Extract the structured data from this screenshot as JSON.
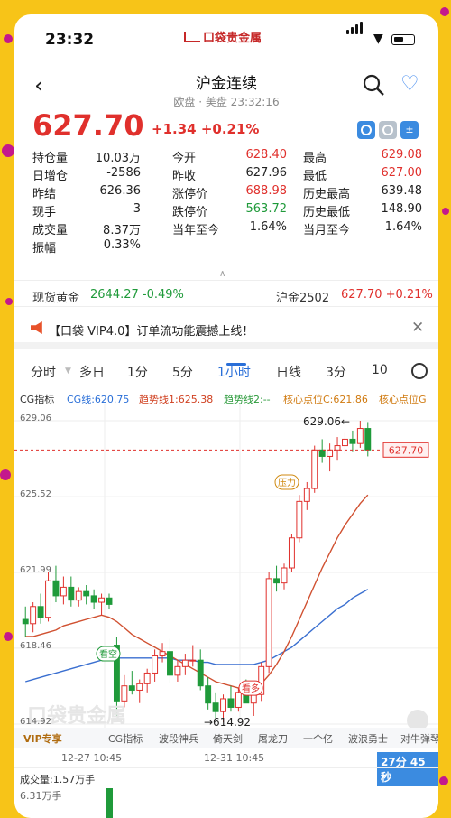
{
  "status_bar": {
    "time": "23:32",
    "brand": "口袋贵金属"
  },
  "header": {
    "title": "沪金连续",
    "subtitle": "欧盘 · 美盘 23:32:16"
  },
  "quote": {
    "price": "627.70",
    "change": "+1.34",
    "change_pct": "+0.21%"
  },
  "stats": [
    [
      {
        "k": "持仓量",
        "v": "10.03万",
        "c": ""
      },
      {
        "k": "今开",
        "v": "628.40",
        "c": "red"
      },
      {
        "k": "最高",
        "v": "629.08",
        "c": "red"
      }
    ],
    [
      {
        "k": "日增仓",
        "v": "-2586",
        "c": ""
      },
      {
        "k": "昨收",
        "v": "627.96",
        "c": ""
      },
      {
        "k": "最低",
        "v": "627.00",
        "c": "red"
      }
    ],
    [
      {
        "k": "昨结",
        "v": "626.36",
        "c": ""
      },
      {
        "k": "涨停价",
        "v": "688.98",
        "c": "red"
      },
      {
        "k": "历史最高",
        "v": "639.48",
        "c": ""
      }
    ],
    [
      {
        "k": "现手",
        "v": "3",
        "c": ""
      },
      {
        "k": "跌停价",
        "v": "563.72",
        "c": "green"
      },
      {
        "k": "历史最低",
        "v": "148.90",
        "c": ""
      }
    ],
    [
      {
        "k": "成交量",
        "v": "8.37万",
        "c": ""
      },
      {
        "k": "当年至今",
        "v": "1.64%",
        "c": ""
      },
      {
        "k": "当月至今",
        "v": "1.64%",
        "c": ""
      }
    ],
    [
      {
        "k": "振幅",
        "v": "0.33%",
        "c": ""
      }
    ]
  ],
  "spot": {
    "left_label": "现货黄金",
    "left_value": "2644.27 -0.49%",
    "right_label": "沪金2502",
    "right_value": "627.70 +0.21%"
  },
  "ad": {
    "text": "【口袋 VIP4.0】订单流功能震撼上线！"
  },
  "tabs": [
    "分时",
    "多日",
    "1分",
    "5分",
    "1小时",
    "日线",
    "3分",
    "10"
  ],
  "indicators": {
    "name": "CG指标",
    "cg": "CG线:620.75",
    "trend1": "趋势线1:625.38",
    "trend2": "趋势线2:--",
    "core_c": "核心点位C:621.86",
    "core_g": "核心点位G"
  },
  "chart_data": {
    "type": "candlestick",
    "y_ticks": [
      "629.06",
      "625.52",
      "621.99",
      "618.46",
      "614.92"
    ],
    "ylim": [
      614.92,
      629.06
    ],
    "last_price_tag": "627.70",
    "high_label": "629.06",
    "low_label": "614.92",
    "annotations": {
      "resist": "压力",
      "bear": "看空",
      "bull": "看多"
    },
    "x_labels": [
      "12-27 10:45",
      "12-31 10:45"
    ],
    "candles": [
      [
        619.8,
        620.4,
        619.0,
        619.6
      ],
      [
        619.6,
        620.6,
        619.2,
        620.4
      ],
      [
        620.4,
        621.0,
        619.6,
        619.9
      ],
      [
        619.9,
        622.0,
        619.7,
        621.6
      ],
      [
        621.6,
        622.3,
        620.6,
        620.9
      ],
      [
        620.9,
        621.8,
        620.5,
        621.3
      ],
      [
        621.3,
        621.8,
        620.4,
        620.7
      ],
      [
        620.7,
        621.3,
        620.4,
        621.1
      ],
      [
        621.1,
        621.4,
        620.5,
        620.9
      ],
      [
        620.9,
        621.2,
        620.3,
        620.6
      ],
      [
        620.6,
        621.0,
        620.0,
        620.8
      ],
      [
        620.8,
        621.0,
        620.3,
        620.5
      ],
      [
        618.6,
        619.0,
        615.3,
        616.0
      ],
      [
        616.0,
        617.2,
        615.7,
        616.7
      ],
      [
        616.7,
        617.4,
        616.3,
        616.5
      ],
      [
        616.5,
        617.0,
        615.9,
        616.8
      ],
      [
        616.8,
        617.5,
        616.4,
        617.3
      ],
      [
        617.3,
        618.4,
        616.9,
        618.1
      ],
      [
        618.1,
        618.7,
        617.8,
        618.3
      ],
      [
        618.3,
        618.9,
        616.8,
        617.2
      ],
      [
        617.2,
        617.9,
        616.9,
        617.6
      ],
      [
        617.6,
        618.2,
        617.2,
        617.9
      ],
      [
        617.9,
        618.6,
        617.6,
        617.9
      ],
      [
        617.9,
        618.4,
        616.5,
        616.7
      ],
      [
        616.7,
        617.1,
        615.6,
        615.9
      ],
      [
        615.9,
        616.4,
        615.2,
        615.5
      ],
      [
        615.5,
        616.3,
        615.0,
        616.1
      ],
      [
        616.1,
        616.7,
        615.5,
        615.7
      ],
      [
        615.7,
        616.6,
        615.5,
        616.4
      ],
      [
        616.4,
        617.0,
        616.0,
        615.9
      ],
      [
        615.9,
        616.5,
        615.3,
        616.3
      ],
      [
        616.3,
        617.8,
        616.0,
        617.6
      ],
      [
        617.6,
        622.0,
        617.3,
        621.7
      ],
      [
        621.7,
        622.3,
        621.1,
        621.5
      ],
      [
        621.5,
        622.4,
        621.2,
        622.2
      ],
      [
        622.2,
        623.8,
        622.0,
        623.6
      ],
      [
        623.6,
        625.6,
        623.4,
        625.3
      ],
      [
        625.3,
        626.2,
        624.9,
        625.9
      ],
      [
        625.9,
        627.9,
        625.7,
        627.7
      ],
      [
        627.7,
        628.2,
        627.1,
        627.4
      ],
      [
        627.4,
        628.0,
        626.7,
        627.7
      ],
      [
        627.7,
        628.3,
        627.2,
        627.9
      ],
      [
        627.9,
        628.5,
        627.5,
        628.2
      ],
      [
        628.2,
        628.6,
        627.6,
        628.0
      ],
      [
        628.0,
        629.06,
        627.8,
        628.7
      ],
      [
        628.7,
        629.0,
        627.4,
        627.7
      ]
    ],
    "ma_red": [
      619.0,
      619.0,
      619.1,
      619.2,
      619.3,
      619.5,
      619.6,
      619.7,
      619.8,
      619.9,
      620.0,
      619.9,
      619.7,
      619.4,
      619.1,
      618.9,
      618.7,
      618.5,
      618.3,
      618.1,
      617.9,
      617.7,
      617.5,
      617.3,
      617.1,
      616.9,
      616.8,
      616.7,
      616.6,
      616.6,
      616.6,
      616.8,
      617.2,
      617.7,
      618.3,
      619.0,
      619.8,
      620.6,
      621.4,
      622.2,
      622.9,
      623.6,
      624.2,
      624.7,
      625.2,
      625.6
    ],
    "ma_blue": [
      616.9,
      617.0,
      617.1,
      617.2,
      617.3,
      617.4,
      617.5,
      617.6,
      617.7,
      617.8,
      617.9,
      618.0,
      618.0,
      618.0,
      618.0,
      618.0,
      618.0,
      618.0,
      618.0,
      618.0,
      617.9,
      617.9,
      617.9,
      617.8,
      617.8,
      617.7,
      617.7,
      617.7,
      617.7,
      617.7,
      617.7,
      617.8,
      617.9,
      618.1,
      618.3,
      618.5,
      618.8,
      619.1,
      619.4,
      619.7,
      620.0,
      620.3,
      620.5,
      620.8,
      621.0,
      621.2
    ]
  },
  "bottom_tools": {
    "vip": "VIP专享",
    "items": [
      "CG指标",
      "波段神兵",
      "倚天剑",
      "屠龙刀",
      "一个亿",
      "波浪勇士",
      "对牛弹琴"
    ]
  },
  "time_axis": {
    "left": "12-27 10:45",
    "mid": "12-31 10:45",
    "countdown": "27分 45秒"
  },
  "volume": {
    "label": "成交量:1.57万手",
    "max": "6.31万手"
  }
}
